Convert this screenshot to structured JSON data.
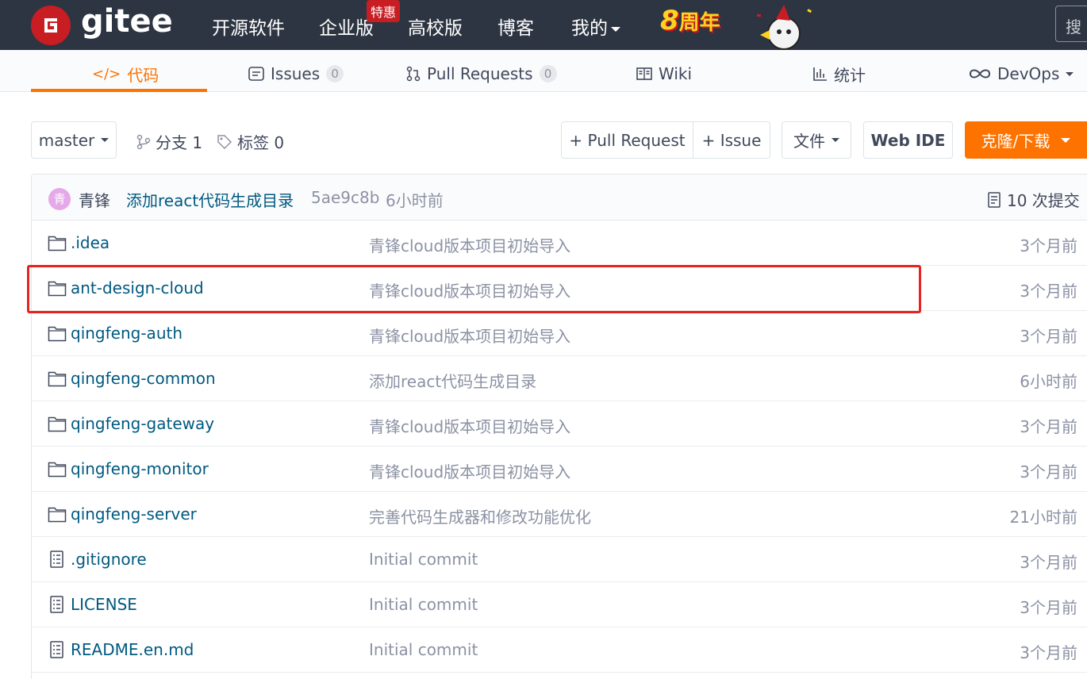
{
  "topnav": {
    "logo_text": "gitee",
    "items": [
      "开源软件",
      "企业版",
      "高校版",
      "博客",
      "我的"
    ],
    "promo_badge": "特惠",
    "anniversary_num": "8",
    "anniversary_text": "周年",
    "search_placeholder": "搜",
    "colors": {
      "bg": "#2e3542",
      "brand": "#c71d23"
    }
  },
  "tabs": [
    {
      "label": "代码",
      "icon": "code-icon",
      "active": true
    },
    {
      "label": "Issues",
      "count": "0",
      "icon": "issues-icon"
    },
    {
      "label": "Pull Requests",
      "count": "0",
      "icon": "pull-request-icon"
    },
    {
      "label": "Wiki",
      "icon": "book-icon"
    },
    {
      "label": "统计",
      "icon": "bar-chart-icon"
    },
    {
      "label": "DevOps",
      "icon": "infinity-icon"
    }
  ],
  "toolbar": {
    "branch": "master",
    "branches_label": "分支 1",
    "tags_label": "标签 0",
    "pull_request_btn": "+ Pull Request",
    "issue_btn": "+ Issue",
    "file_btn": "文件",
    "web_ide_btn": "Web IDE",
    "clone_btn": "克隆/下载",
    "accent": "#fe7300"
  },
  "commit": {
    "avatar_char": "青",
    "author": "青锋",
    "message": "添加react代码生成目录",
    "sha": "5ae9c8b",
    "time": "6小时前",
    "count_label": "10 次提交"
  },
  "files": [
    {
      "type": "folder",
      "name": ".idea",
      "message": "青锋cloud版本项目初始导入",
      "time": "3个月前"
    },
    {
      "type": "folder",
      "name": "ant-design-cloud",
      "message": "青锋cloud版本项目初始导入",
      "time": "3个月前"
    },
    {
      "type": "folder",
      "name": "qingfeng-auth",
      "message": "青锋cloud版本项目初始导入",
      "time": "3个月前"
    },
    {
      "type": "folder",
      "name": "qingfeng-common",
      "message": "添加react代码生成目录",
      "time": "6小时前"
    },
    {
      "type": "folder",
      "name": "qingfeng-gateway",
      "message": "青锋cloud版本项目初始导入",
      "time": "3个月前"
    },
    {
      "type": "folder",
      "name": "qingfeng-monitor",
      "message": "青锋cloud版本项目初始导入",
      "time": "3个月前"
    },
    {
      "type": "folder",
      "name": "qingfeng-server",
      "message": "完善代码生成器和修改功能优化",
      "time": "21小时前"
    },
    {
      "type": "file",
      "name": ".gitignore",
      "message": "Initial commit",
      "time": "3个月前"
    },
    {
      "type": "file",
      "name": "LICENSE",
      "message": "Initial commit",
      "time": "3个月前"
    },
    {
      "type": "file",
      "name": "README.en.md",
      "message": "Initial commit",
      "time": "3个月前"
    }
  ],
  "highlight_color": "#e8221f"
}
